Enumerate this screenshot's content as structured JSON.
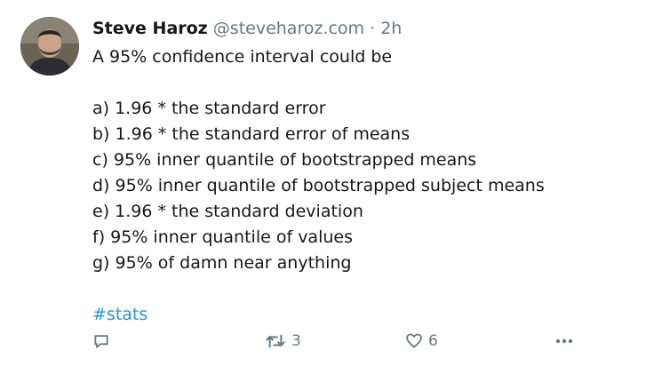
{
  "tweet": {
    "author": {
      "name": "Steve Haroz",
      "handle": "@steveharoz.com",
      "separator": "·",
      "time": "2h"
    },
    "lines": [
      "A 95% confidence interval could be",
      "",
      "a) 1.96 * the standard error",
      "b) 1.96 * the standard error of means",
      "c) 95% inner quantile of bootstrapped means",
      "d) 95% inner quantile of bootstrapped subject means",
      "e) 1.96 * the standard deviation",
      "f) 95% inner quantile of values",
      "g) 95% of damn near anything",
      ""
    ],
    "hashtag": "#stats",
    "actions": {
      "reply_icon": "reply-icon",
      "retweet_icon": "retweet-icon",
      "retweet_count": "3",
      "like_icon": "heart-icon",
      "like_count": "6",
      "more_icon": "more-icon"
    }
  },
  "colors": {
    "text": "#14171a",
    "secondary": "#657786",
    "link": "#1b95e0"
  }
}
